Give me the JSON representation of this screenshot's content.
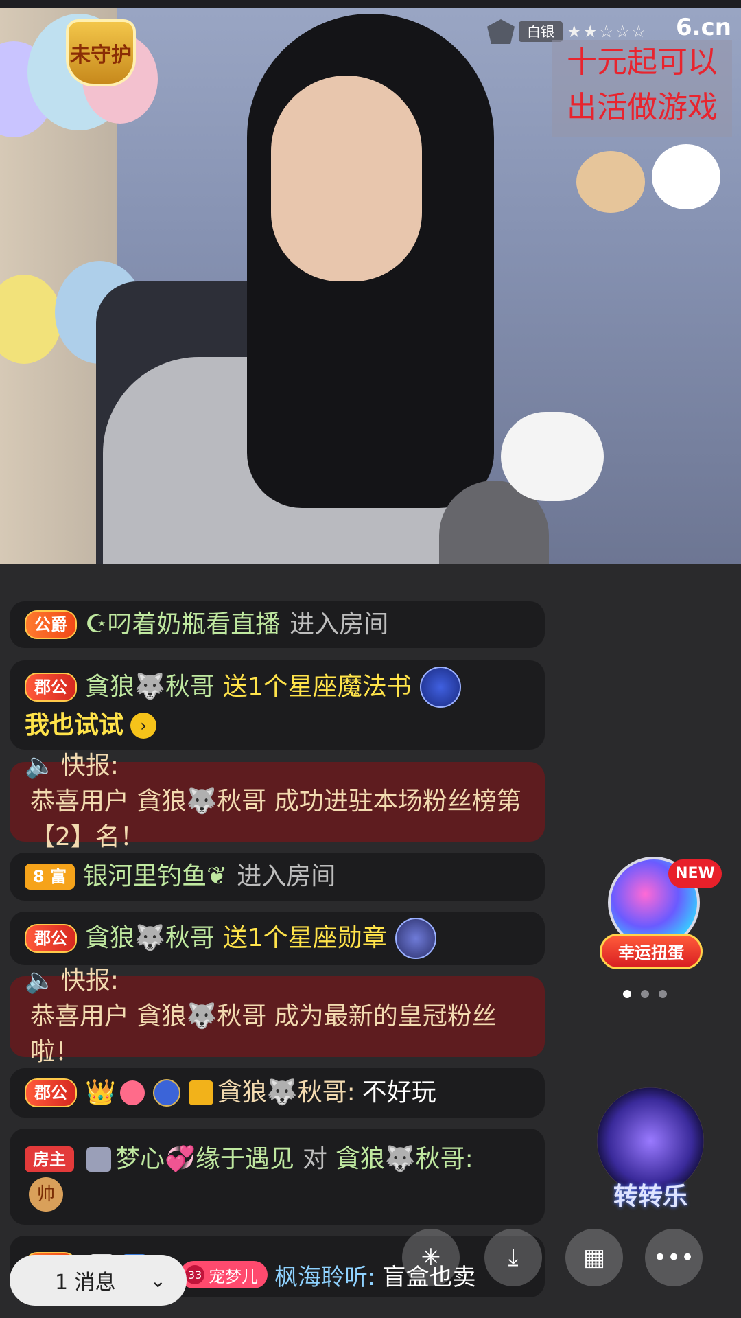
{
  "stream": {
    "guard_badge": "未守护",
    "rank_tier": "白银",
    "rank_stars": "★★☆☆☆",
    "site_logo": "6.cn",
    "promo_line1": "十元起可以",
    "promo_line2": "出活做游戏"
  },
  "chat": [
    {
      "badge": "公爵",
      "user": "☪叼着奶瓶看直播",
      "action": "进入房间"
    },
    {
      "badge": "郡公",
      "user": "貪狼🐺秋哥",
      "action": "送1个星座魔法书",
      "cta": "我也试试"
    },
    {
      "alert_prefix": "快报:",
      "text": "恭喜用户 貪狼🐺秋哥 成功进驻本场粉丝榜第【2】名！"
    },
    {
      "badge": "8 富",
      "user": "银河里钓鱼❦",
      "action": "进入房间"
    },
    {
      "badge": "郡公",
      "user": "貪狼🐺秋哥",
      "action": "送1个星座勋章"
    },
    {
      "alert_prefix": "快报:",
      "text": "恭喜用户 貪狼🐺秋哥 成为最新的皇冠粉丝啦！"
    },
    {
      "badge": "郡公",
      "user": "貪狼🐺秋哥:",
      "message": "不好玩"
    },
    {
      "badge": "房主",
      "user": "梦心💞缘于遇见",
      "joiner": "对",
      "target": "貪狼🐺秋哥:",
      "message": "帅"
    },
    {
      "badge": "子爵",
      "pet_level": "33",
      "pet_name": "宠梦儿",
      "user": "枫海聆听:",
      "message": "盲盒也卖"
    }
  ],
  "widgets": {
    "capsule_label": "幸运扭蛋",
    "capsule_new": "NEW",
    "wheel_label": "转转乐"
  },
  "bottom": {
    "message_count": "1 消息"
  },
  "icons": {
    "chevron": "chevron-down-icon",
    "grid": "grid-icon",
    "more": "more-icon",
    "download": "download-icon",
    "share": "share-icon"
  }
}
